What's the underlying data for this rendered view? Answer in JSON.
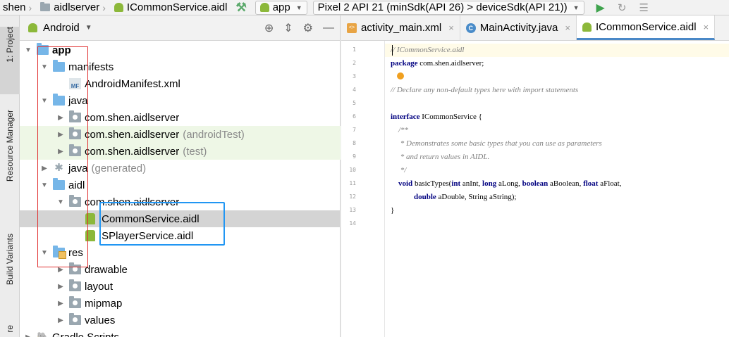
{
  "topbar": {
    "crumbs": [
      "shen",
      "aidlserver",
      "ICommonService.aidl"
    ],
    "run_config": "app",
    "device": "Pixel 2 API 21 (minSdk(API 26) > deviceSdk(API 21))"
  },
  "leftstrip": {
    "tabs": [
      "1: Project",
      "Resource Manager",
      "Build Variants",
      "re"
    ]
  },
  "project": {
    "view_mode": "Android",
    "tree": [
      {
        "label": "app",
        "suffix": "",
        "depth": 0,
        "icon": "app-folder-icon",
        "expanded": true
      },
      {
        "label": "manifests",
        "suffix": "",
        "depth": 1,
        "icon": "folder-icon",
        "expanded": true
      },
      {
        "label": "AndroidManifest.xml",
        "suffix": "",
        "depth": 2,
        "icon": "manifest-file-icon",
        "expanded": null
      },
      {
        "label": "java",
        "suffix": "",
        "depth": 1,
        "icon": "folder-icon",
        "expanded": true
      },
      {
        "label": "com.shen.aidlserver",
        "suffix": "",
        "depth": 2,
        "icon": "package-icon",
        "expanded": false
      },
      {
        "label": "com.shen.aidlserver",
        "suffix": "(androidTest)",
        "depth": 2,
        "icon": "package-icon",
        "expanded": false
      },
      {
        "label": "com.shen.aidlserver",
        "suffix": "(test)",
        "depth": 2,
        "icon": "package-icon",
        "expanded": false
      },
      {
        "label": "java",
        "suffix": "(generated)",
        "depth": 1,
        "icon": "generated-folder-icon",
        "expanded": false
      },
      {
        "label": "aidl",
        "suffix": "",
        "depth": 1,
        "icon": "folder-icon",
        "expanded": true
      },
      {
        "label": "com.shen.aidlserver",
        "suffix": "",
        "depth": 2,
        "icon": "package-icon",
        "expanded": true
      },
      {
        "label": "ICommonService.aidl",
        "suffix": "",
        "depth": 3,
        "icon": "aidl-file-icon",
        "expanded": null
      },
      {
        "label": "ISPlayerService.aidl",
        "suffix": "",
        "depth": 3,
        "icon": "aidl-file-icon",
        "expanded": null
      },
      {
        "label": "res",
        "suffix": "",
        "depth": 1,
        "icon": "res-folder-icon",
        "expanded": true
      },
      {
        "label": "drawable",
        "suffix": "",
        "depth": 2,
        "icon": "package-icon",
        "expanded": false
      },
      {
        "label": "layout",
        "suffix": "",
        "depth": 2,
        "icon": "package-icon",
        "expanded": false
      },
      {
        "label": "mipmap",
        "suffix": "",
        "depth": 2,
        "icon": "package-icon",
        "expanded": false
      },
      {
        "label": "values",
        "suffix": "",
        "depth": 2,
        "icon": "package-icon",
        "expanded": false
      },
      {
        "label": "Gradle Scripts",
        "suffix": "",
        "depth": 0,
        "icon": "gradle-icon",
        "expanded": false
      }
    ]
  },
  "editor": {
    "tabs": [
      {
        "label": "activity_main.xml",
        "icon": "xml-file-icon",
        "active": false
      },
      {
        "label": "MainActivity.java",
        "icon": "class-icon",
        "active": false
      },
      {
        "label": "ICommonService.aidl",
        "icon": "aidl-file-icon",
        "active": true
      }
    ],
    "close_glyph": "×",
    "line_numbers": [
      "1",
      "2",
      "3",
      "4",
      "5",
      "6",
      "7",
      "8",
      "9",
      "10",
      "11",
      "12",
      "13",
      "14"
    ],
    "lines": [
      "// ICommonService.aidl",
      "package com.shen.aidlserver;",
      "",
      "// Declare any non-default types here with import statements",
      "",
      "interface ICommonService {",
      "    /**",
      "     * Demonstrates some basic types that you can use as parameters",
      "     * and return values in AIDL.",
      "     */",
      "    void basicTypes(int anInt, long aLong, boolean aBoolean, float aFloat,",
      "            double aDouble, String aString);",
      "}",
      ""
    ]
  },
  "colors": {
    "annotation_red": "#e03030",
    "annotation_blue": "#2196f3",
    "selected_row": "#d4d4d4",
    "test_row": "#eef7e6"
  }
}
